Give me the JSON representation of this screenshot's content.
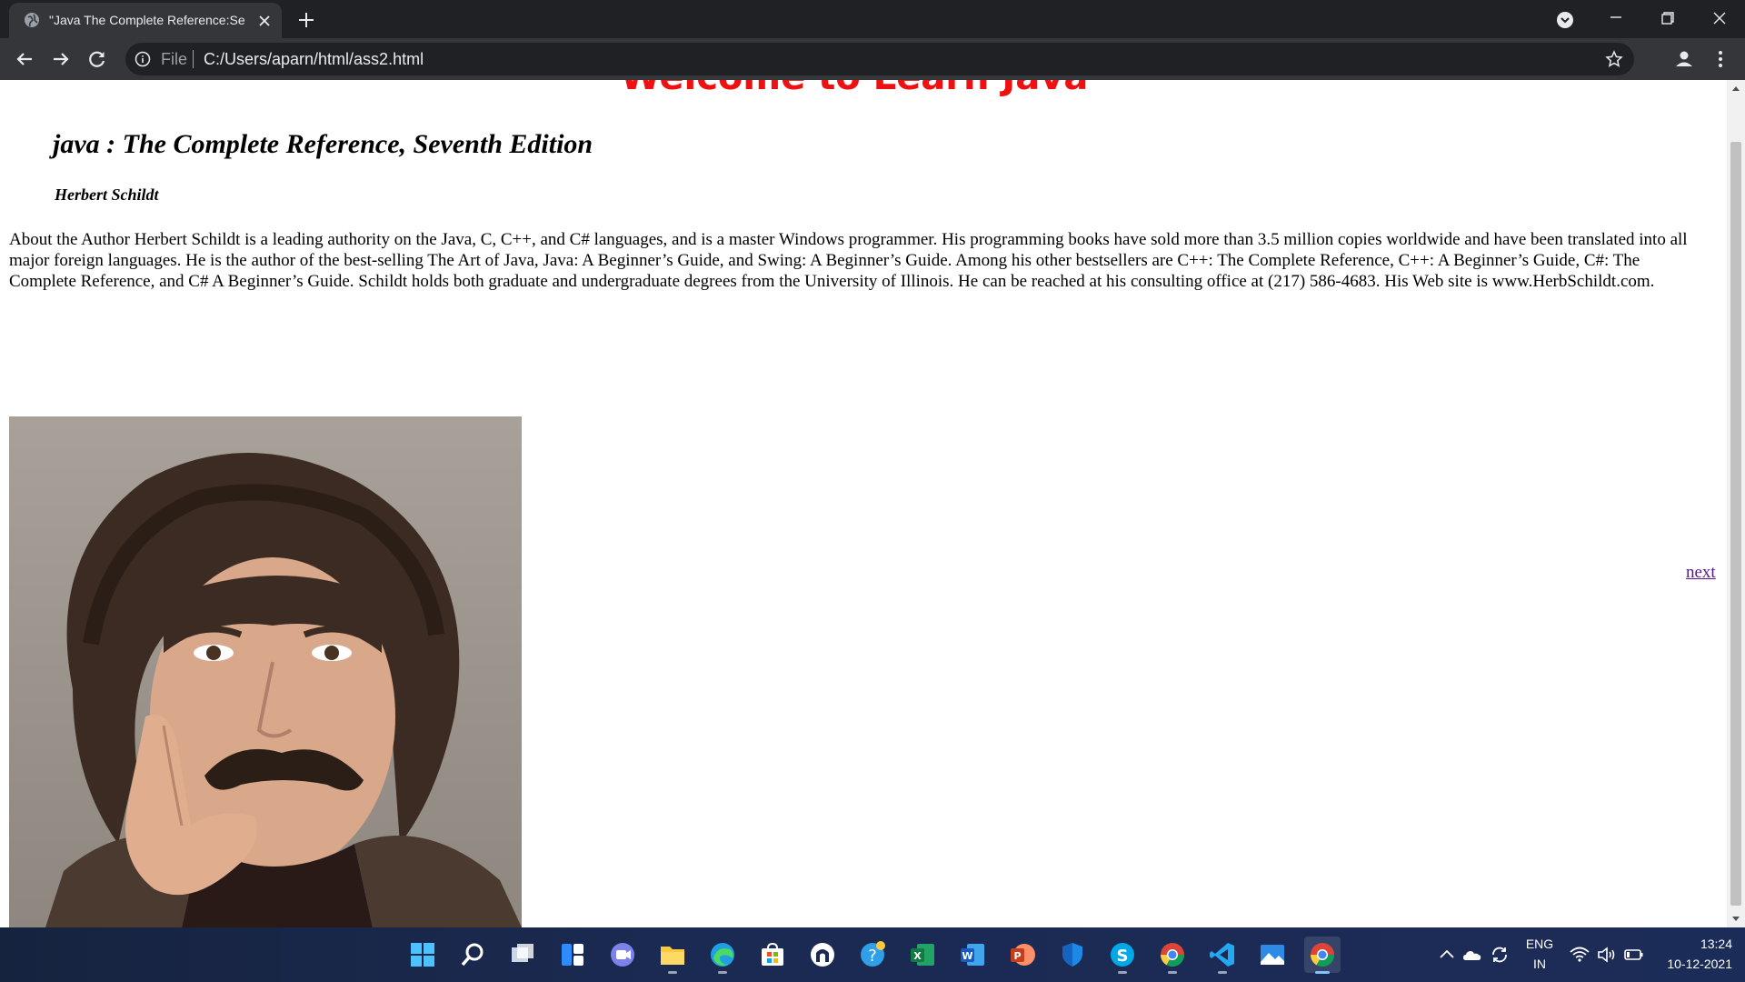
{
  "browser": {
    "tab_title": "\"Java The Complete Reference:Se",
    "omnibox_scheme": "File",
    "url": "C:/Users/aparn/html/ass2.html"
  },
  "page": {
    "welcome": "Welcome to Learn Java",
    "book_title": "java : The Complete Reference, Seventh Edition",
    "author": "Herbert Schildt",
    "about": "About the Author Herbert Schildt is a leading authority on the Java, C, C++, and C# languages, and is a master Windows programmer. His programming books have sold more than 3.5 million copies worldwide and have been translated into all major foreign languages. He is the author of the best-selling The Art of Java, Java: A Beginner’s Guide, and Swing: A Beginner’s Guide. Among his other bestsellers are C++: The Complete Reference, C++: A Beginner’s Guide, C#: The Complete Reference, and C# A Beginner’s Guide. Schildt holds both graduate and undergraduate degrees from the University of Illinois. He can be reached at his consulting office at (217) 586-4683. His Web site is www.HerbSchildt.com.",
    "next_link": "next"
  },
  "taskbar": {
    "apps": [
      "start-icon",
      "search-icon",
      "task-view-icon",
      "widgets-icon",
      "chat-icon",
      "file-explorer-icon",
      "edge-icon",
      "store-icon",
      "app-icon",
      "help-icon",
      "excel-icon",
      "word-icon",
      "powerpoint-icon",
      "defender-icon",
      "skype-icon",
      "chrome-icon",
      "vscode-icon",
      "photos-icon",
      "chrome-active-icon"
    ],
    "language": "ENG",
    "region": "IN",
    "time": "13:24",
    "date": "10-12-2021"
  },
  "colors": {
    "welcome_red": "#ee1111",
    "link_purple": "#551a8b",
    "chrome_dark": "#202124",
    "taskbar_blue": "#1b2a52"
  }
}
